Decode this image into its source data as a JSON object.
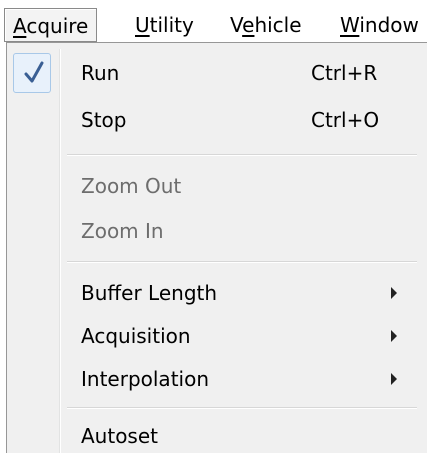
{
  "menubar": {
    "items": [
      {
        "label": "Acquire"
      },
      {
        "label": "Utility"
      },
      {
        "label": "Vehicle"
      },
      {
        "label": "Window"
      }
    ]
  },
  "dropdown": {
    "items": [
      {
        "label": "Run",
        "shortcut": "Ctrl+R",
        "checked": true,
        "enabled": true
      },
      {
        "label": "Stop",
        "shortcut": "Ctrl+O",
        "enabled": true
      },
      {
        "label": "Zoom Out",
        "enabled": false
      },
      {
        "label": "Zoom In",
        "enabled": false
      },
      {
        "label": "Buffer Length",
        "submenu": true,
        "enabled": true
      },
      {
        "label": "Acquisition",
        "submenu": true,
        "enabled": true
      },
      {
        "label": "Interpolation",
        "submenu": true,
        "enabled": true
      },
      {
        "label": "Autoset",
        "enabled": true
      }
    ]
  },
  "icons": {
    "check": "checkmark-icon",
    "submenu": "submenu-arrow-icon"
  },
  "colors": {
    "menu_bg": "#f0f0f0",
    "check_color": "#3a5f94",
    "disabled_text": "#6d6d6d"
  }
}
